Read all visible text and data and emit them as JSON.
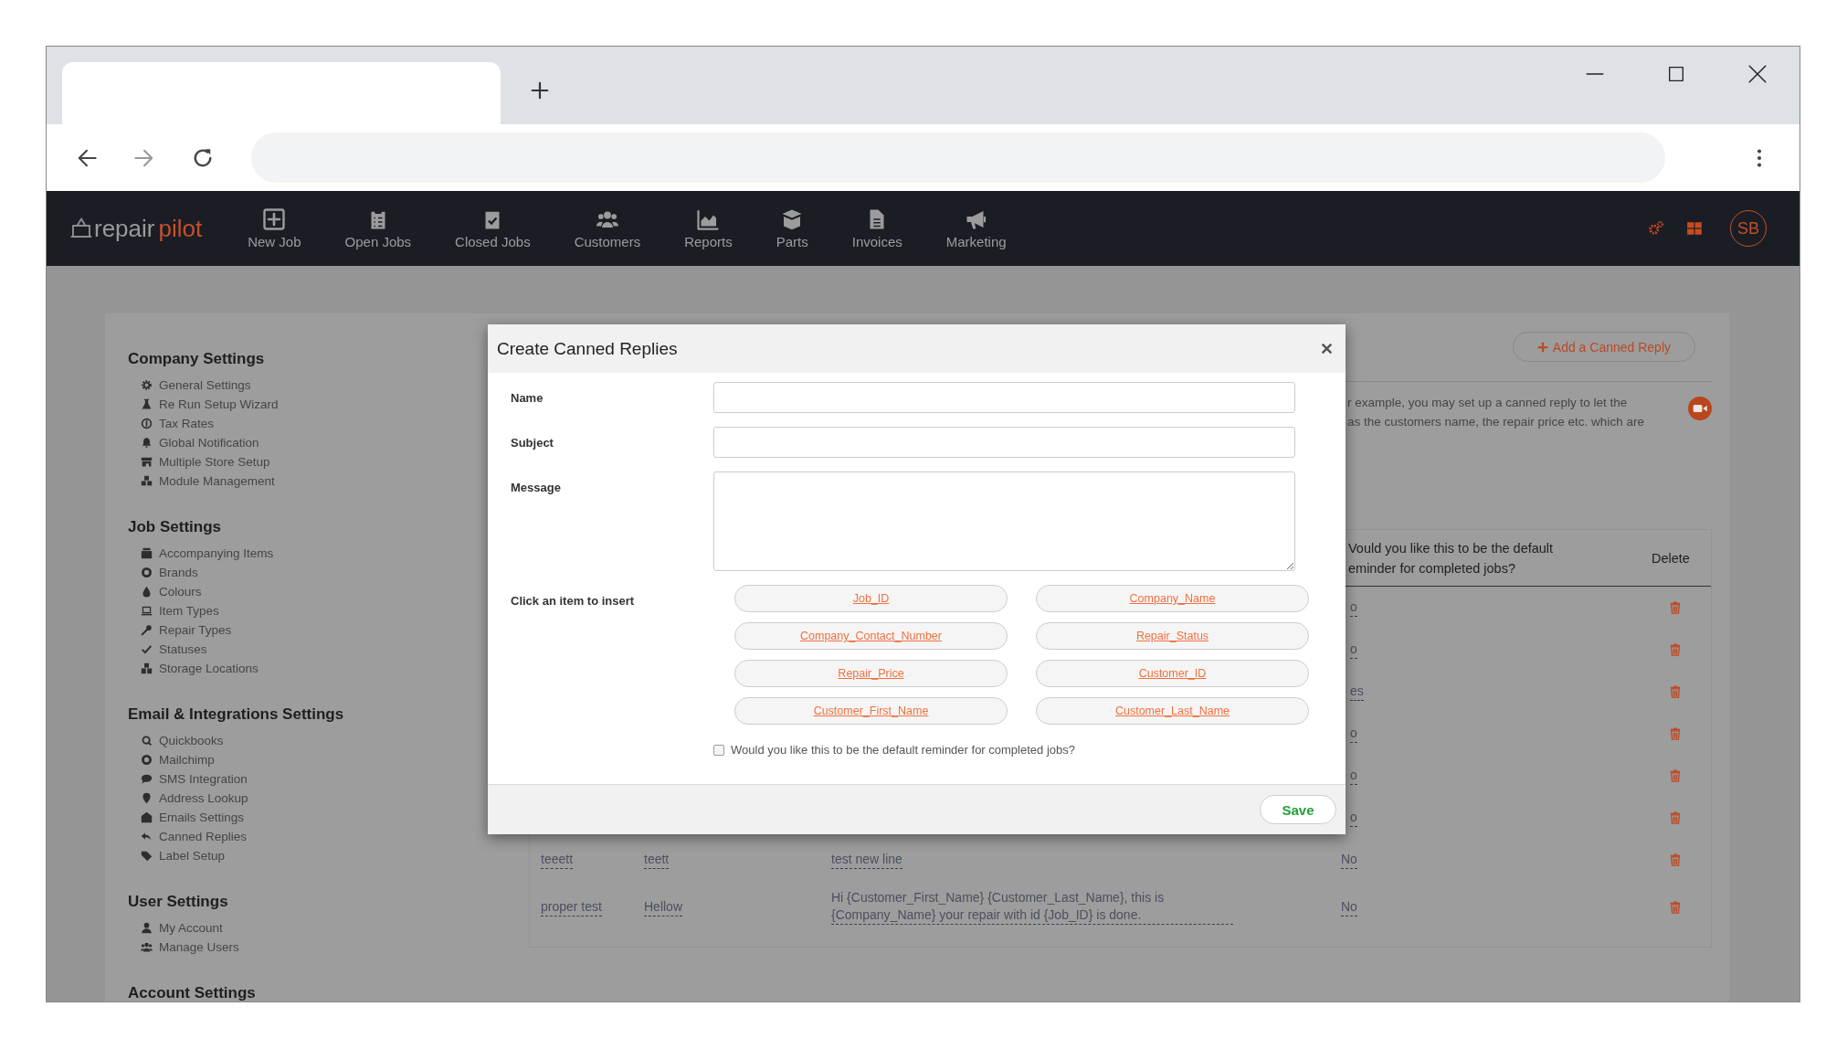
{
  "app": {
    "logo": {
      "part_1": "repair",
      "part_2": "pilot"
    },
    "nav": [
      {
        "label": "New Job"
      },
      {
        "label": "Open Jobs"
      },
      {
        "label": "Closed Jobs"
      },
      {
        "label": "Customers"
      },
      {
        "label": "Reports"
      },
      {
        "label": "Parts"
      },
      {
        "label": "Invoices"
      },
      {
        "label": "Marketing"
      }
    ],
    "avatar": "SB"
  },
  "sidebar": {
    "sections": [
      {
        "title": "Company Settings",
        "items": [
          "General Settings",
          "Re Run Setup Wizard",
          "Tax Rates",
          "Global Notification",
          "Multiple Store Setup",
          "Module Management"
        ]
      },
      {
        "title": "Job Settings",
        "items": [
          "Accompanying Items",
          "Brands",
          "Colours",
          "Item Types",
          "Repair Types",
          "Statuses",
          "Storage Locations"
        ]
      },
      {
        "title": "Email & Integrations Settings",
        "items": [
          "Quickbooks",
          "Mailchimp",
          "SMS Integration",
          "Address Lookup",
          "Emails Settings",
          "Canned Replies",
          "Label Setup"
        ]
      },
      {
        "title": "User Settings",
        "items": [
          "My Account",
          "Manage Users"
        ]
      },
      {
        "title": "Account Settings"
      }
    ]
  },
  "page": {
    "add_button": "Add a Canned Reply",
    "description": [
      "r example, you may set up a canned reply to let the",
      "as the customers name, the repair price etc. which are"
    ],
    "table": {
      "columns": [
        {
          "lines": [
            "Vould you like this to be the default",
            "eminder for completed jobs?"
          ]
        },
        {
          "lines": [
            "Delete"
          ]
        }
      ],
      "rows": [
        {
          "default": "o"
        },
        {
          "default": "o"
        },
        {
          "default": "es"
        },
        {
          "default": "o"
        },
        {
          "default": "o"
        },
        {
          "default": "o"
        },
        {
          "name": "teeett",
          "subject": "teett",
          "message": "test new line",
          "default": "No"
        },
        {
          "name": "proper test",
          "subject": "Hellow",
          "message": "Hi {Customer_First_Name} {Customer_Last_Name}, this is {Company_Name} your repair with id {Job_ID} is done.",
          "default": "No"
        }
      ]
    }
  },
  "modal": {
    "title": "Create Canned Replies",
    "fields": [
      {
        "label": "Name",
        "kind": "input"
      },
      {
        "label": "Subject",
        "kind": "input"
      },
      {
        "label": "Message",
        "kind": "textarea"
      }
    ],
    "insert_label": "Click an item to insert",
    "insert_items": [
      "Job_ID",
      "Company_Name",
      "Company_Contact_Number",
      "Repair_Status",
      "Repair_Price",
      "Customer_ID",
      "Customer_First_Name",
      "Customer_Last_Name"
    ],
    "checkbox": {
      "label": "Would you like this to be the default reminder for completed jobs?",
      "checked": false
    },
    "save_button": "Save"
  }
}
